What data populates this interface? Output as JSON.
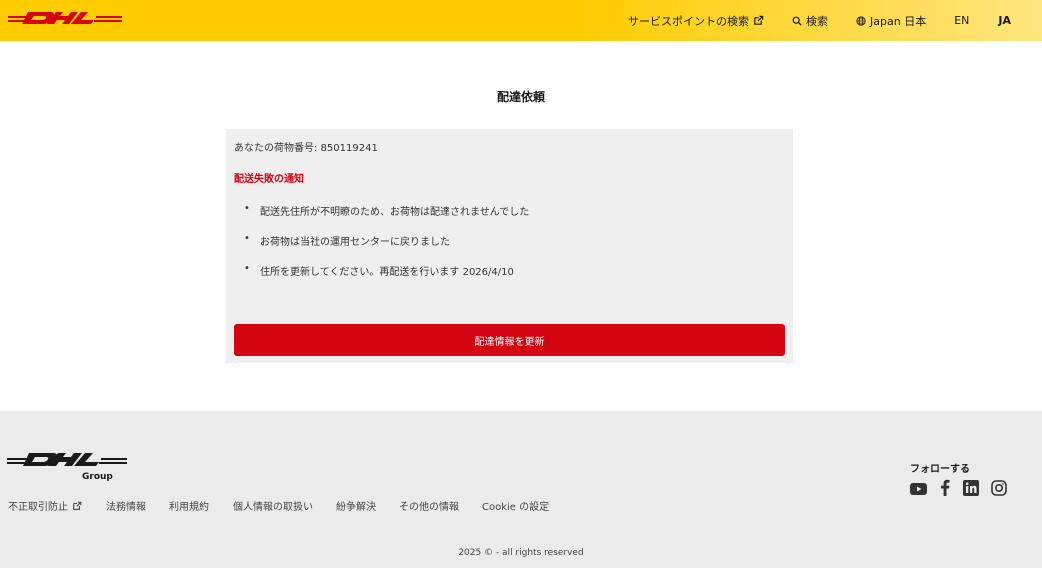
{
  "header": {
    "logo_icon": "dhl-logo",
    "nav": {
      "service_point": "サービスポイントの検索",
      "service_point_icon": "external-link-icon",
      "search": "検索",
      "search_icon": "search-icon",
      "region": "Japan 日本",
      "region_icon": "globe-icon",
      "lang_en": "EN",
      "lang_ja": "JA"
    }
  },
  "main": {
    "title": "配達依頼",
    "tracking_text": "あなたの荷物番号: 850119241",
    "notice_title": "配送失敗の通知",
    "bullets": [
      "配送先住所が不明瞭のため、お荷物は配達されませんでした",
      "お荷物は当社の運用センターに戻りました",
      "住所を更新してください。再配送を行います 2026/4/10"
    ],
    "update_button": "配達情報を更新"
  },
  "footer": {
    "logo_group_text": "Group",
    "links": [
      "不正取引防止",
      "法務情報",
      "利用規約",
      "個人情報の取扱い",
      "紛争解決",
      "その他の情報",
      "Cookie の設定"
    ],
    "follow_label": "フォローする",
    "social_icons": [
      "youtube-icon",
      "facebook-icon",
      "linkedin-icon",
      "instagram-icon"
    ],
    "copyright": "2025 © - all rights reserved"
  },
  "colors": {
    "brand_yellow": "#ffcc00",
    "brand_red": "#d40511",
    "card_bg": "#efefef",
    "footer_bg": "#ebebeb"
  }
}
